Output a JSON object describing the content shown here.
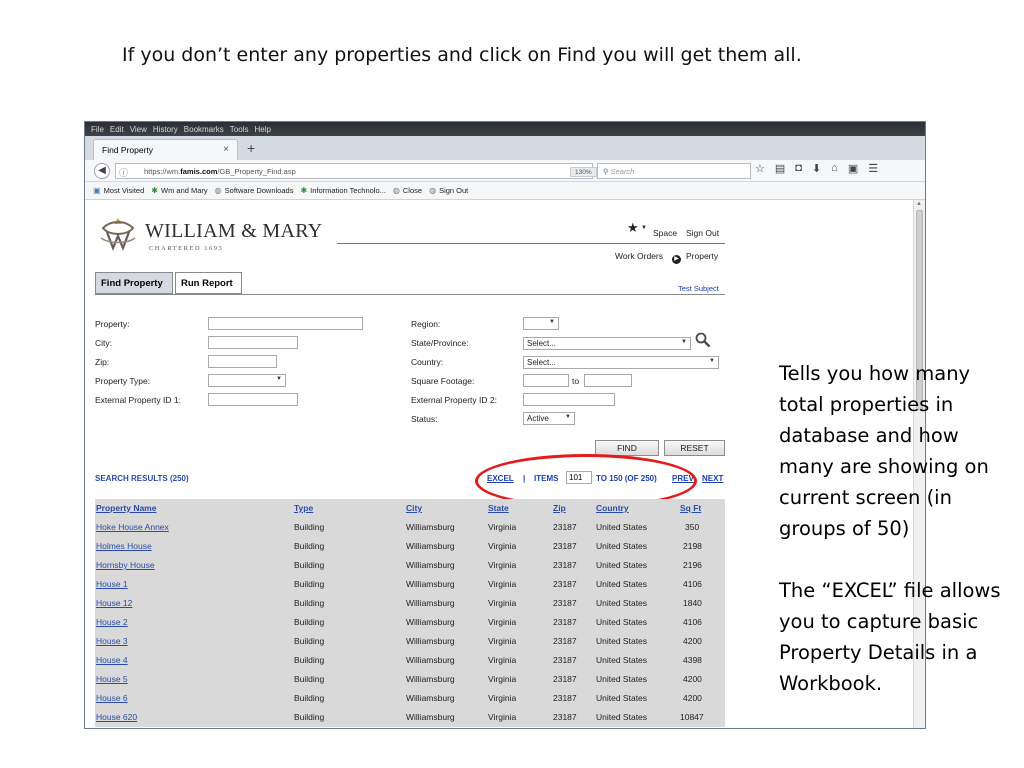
{
  "slide": {
    "title": "If you don’t enter any properties and click on Find you will get them all.",
    "note_1": "Tells you how many total properties in database and how many are showing on current screen (in groups of 50)",
    "note_2": "The “EXCEL” file allows you to capture basic Property Details in a Workbook."
  },
  "browser": {
    "menu": [
      "File",
      "Edit",
      "View",
      "History",
      "Bookmarks",
      "Tools",
      "Help"
    ],
    "tab_title": "Find Property",
    "tab_close": "×",
    "new_tab": "+",
    "url_prefix": "https://wm.",
    "url_domain": "famis.com",
    "url_path": "/GB_Property_Find.asp",
    "zoom": "130%",
    "search_placeholder": "Search",
    "bookmarks": [
      "Most Visited",
      "Wm and Mary",
      "Software Downloads",
      "Information Technolo...",
      "Close",
      "Sign Out"
    ]
  },
  "header": {
    "brand": "WILLIAM & MARY",
    "brand_sub": "CHARTERED 1693",
    "space": "Space",
    "sign_out": "Sign Out",
    "work_orders": "Work Orders",
    "property": "Property",
    "user": "Test Subject",
    "tabs": [
      "Find Property",
      "Run Report"
    ]
  },
  "form": {
    "labels": {
      "property": "Property:",
      "city": "City:",
      "zip": "Zip:",
      "property_type": "Property Type:",
      "ext_id_1": "External Property ID 1:",
      "region": "Region:",
      "state": "State/Province:",
      "country": "Country:",
      "sqft": "Square Footage:",
      "sqft_to": "to",
      "ext_id_2": "External Property ID 2:",
      "status": "Status:"
    },
    "values": {
      "state": "Select...",
      "country": "Select...",
      "status": "Active"
    },
    "find_button": "FIND",
    "reset_button": "RESET"
  },
  "results": {
    "title": "SEARCH RESULTS (250)",
    "excel": "EXCEL",
    "sep": "|",
    "items_label": "ITEMS",
    "items_from": "101",
    "items_to": "TO 150 (OF 250)",
    "prev": "PREV",
    "next": "NEXT",
    "columns": [
      "Property Name",
      "Type",
      "City",
      "State",
      "Zip",
      "Country",
      "Sq Ft"
    ],
    "rows": [
      [
        "Hoke House Annex",
        "Building",
        "Williamsburg",
        "Virginia",
        "23187",
        "United States",
        "350"
      ],
      [
        "Holmes House",
        "Building",
        "Williamsburg",
        "Virginia",
        "23187",
        "United States",
        "2198"
      ],
      [
        "Hornsby House",
        "Building",
        "Williamsburg",
        "Virginia",
        "23187",
        "United States",
        "2196"
      ],
      [
        "House 1",
        "Building",
        "Williamsburg",
        "Virginia",
        "23187",
        "United States",
        "4106"
      ],
      [
        "House 12",
        "Building",
        "Williamsburg",
        "Virginia",
        "23187",
        "United States",
        "1840"
      ],
      [
        "House 2",
        "Building",
        "Williamsburg",
        "Virginia",
        "23187",
        "United States",
        "4106"
      ],
      [
        "House 3",
        "Building",
        "Williamsburg",
        "Virginia",
        "23187",
        "United States",
        "4200"
      ],
      [
        "House 4",
        "Building",
        "Williamsburg",
        "Virginia",
        "23187",
        "United States",
        "4398"
      ],
      [
        "House 5",
        "Building",
        "Williamsburg",
        "Virginia",
        "23187",
        "United States",
        "4200"
      ],
      [
        "House 6",
        "Building",
        "Williamsburg",
        "Virginia",
        "23187",
        "United States",
        "4200"
      ],
      [
        "House 620",
        "Building",
        "Williamsburg",
        "Virginia",
        "23187",
        "United States",
        "10847"
      ]
    ]
  },
  "colors": {
    "link_blue": "#2a4ca8",
    "highlight_red": "#e41b1b",
    "table_bg": "#d9d9d9"
  }
}
